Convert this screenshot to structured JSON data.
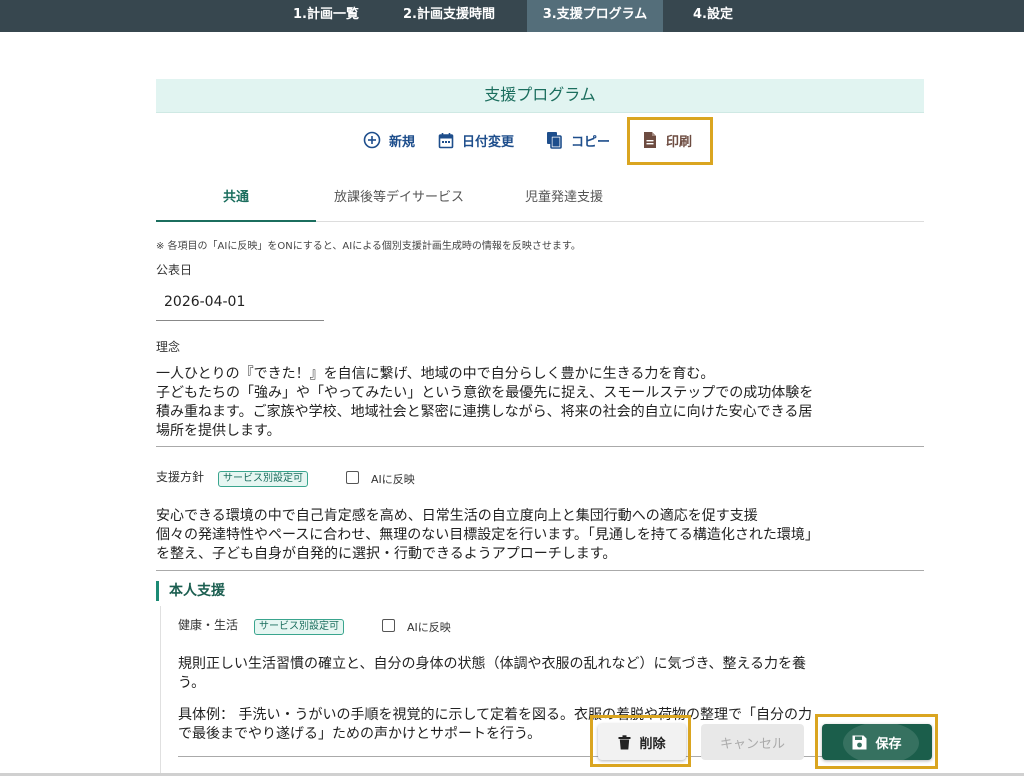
{
  "nav": {
    "tabs": [
      {
        "label": "1.計画一覧"
      },
      {
        "label": "2.計画支援時間"
      },
      {
        "label": "3.支援プログラム",
        "active": true
      },
      {
        "label": "4.設定"
      }
    ]
  },
  "page": {
    "title": "支援プログラム"
  },
  "toolbar": {
    "new": "新規",
    "date_change": "日付変更",
    "copy": "コピー",
    "print": "印刷"
  },
  "tabs": [
    "共通",
    "放課後等デイサービス",
    "児童発達支援"
  ],
  "note": "※ 各項目の「AIに反映」をONにすると、AIによる個別支援計画生成時の情報を反映させます。",
  "publish_date": {
    "label": "公表日",
    "value": "2026-04-01"
  },
  "philosophy": {
    "label": "理念",
    "lines": [
      "一人ひとりの『できた！』を自信に繋げ、地域の中で自分らしく豊かに生きる力を育む。",
      "子どもたちの「強み」や「やってみたい」という意欲を最優先に捉え、スモールステップでの成功体験を",
      "積み重ねます。ご家族や学校、地域社会と緊密に連携しながら、将来の社会的自立に向けた安心できる居",
      "場所を提供します。"
    ]
  },
  "policy": {
    "label": "支援方針",
    "chip": "サービス別設定可",
    "ai_label": "AIに反映",
    "ai_checked": false,
    "lines": [
      "安心できる環境の中で自己肯定感を高め、日常生活の自立度向上と集団行動への適応を促す支援",
      "個々の発達特性やペースに合わせ、無理のない目標設定を行います。「見通しを持てる構造化された環境」",
      "を整え、子ども自身が自発的に選択・行動できるようアプローチします。"
    ]
  },
  "section": {
    "title": "本人支援"
  },
  "health": {
    "label": "健康・生活",
    "chip": "サービス別設定可",
    "ai_label": "AIに反映",
    "ai_checked": false,
    "lines": [
      "規則正しい生活習慣の確立と、自分の身体の状態（体調や衣服の乱れなど）に気づき、整える力を養",
      "う。",
      "",
      "具体例： 手洗い・うがいの手順を視覚的に示して定着を図る。衣服の着脱や荷物の整理で「自分の力",
      "で最後までやり遂げる」ための声かけとサポートを行う。"
    ]
  },
  "actions": {
    "delete": "削除",
    "cancel": "キャンセル",
    "save": "保存"
  },
  "colors": {
    "accent": "#1b6e5e",
    "nav_bg": "#37474f",
    "highlight": "#daa520",
    "save_bg": "#1b5e4b"
  }
}
